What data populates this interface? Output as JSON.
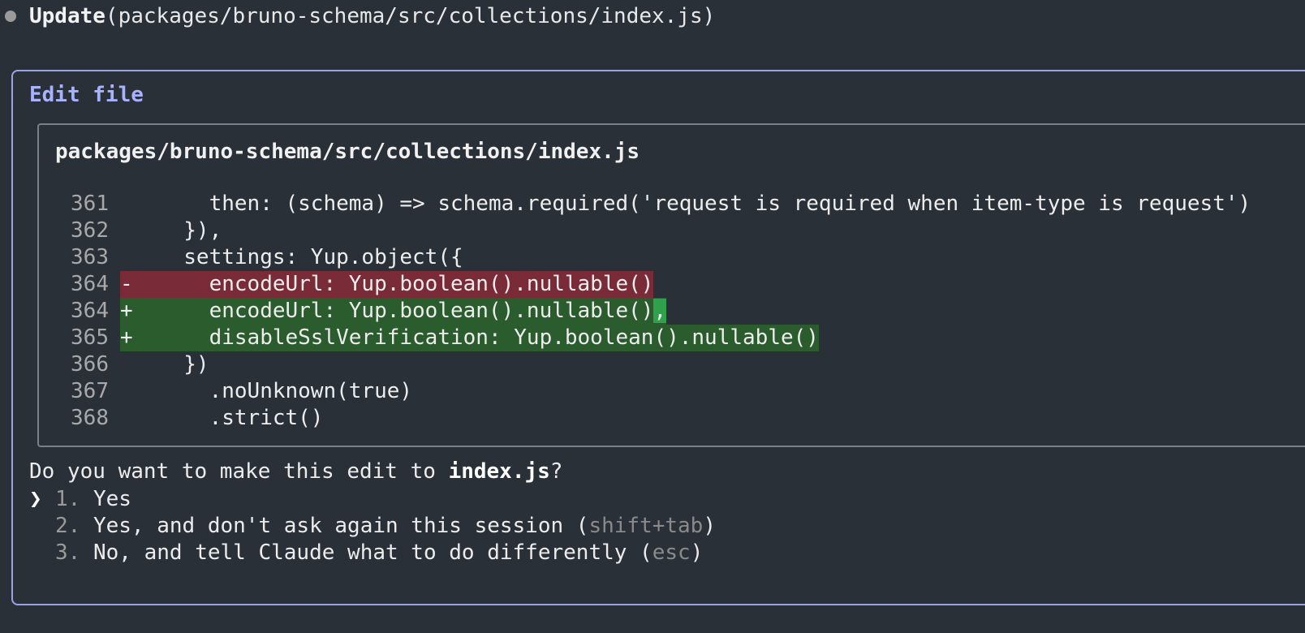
{
  "header": {
    "action": "Update",
    "path_open": "(",
    "path": "packages/bruno-schema/src/collections/index.js",
    "path_close": ")"
  },
  "panel": {
    "title": "Edit file",
    "file_path": "packages/bruno-schema/src/collections/index.js"
  },
  "diff": [
    {
      "ln": "361",
      "marker": " ",
      "type": "context",
      "text": "      then: (schema) => schema.required('request is required when item-type is request')"
    },
    {
      "ln": "362",
      "marker": " ",
      "type": "context",
      "text": "    }),"
    },
    {
      "ln": "363",
      "marker": " ",
      "type": "context",
      "text": "    settings: Yup.object({"
    },
    {
      "ln": "364",
      "marker": "-",
      "type": "removed",
      "text": "      encodeUrl: Yup.boolean().nullable()"
    },
    {
      "ln": "364",
      "marker": "+",
      "type": "added",
      "text": "      encodeUrl: Yup.boolean().nullable()",
      "highlight": ","
    },
    {
      "ln": "365",
      "marker": "+",
      "type": "added",
      "text": "      disableSslVerification: Yup.boolean().nullable()"
    },
    {
      "ln": "366",
      "marker": " ",
      "type": "context",
      "text": "    })"
    },
    {
      "ln": "367",
      "marker": " ",
      "type": "context",
      "text": "      .noUnknown(true)"
    },
    {
      "ln": "368",
      "marker": " ",
      "type": "context",
      "text": "      .strict()"
    }
  ],
  "prompt": {
    "question_prefix": "Do you want to make this edit to ",
    "question_file": "index.js",
    "question_suffix": "?",
    "caret": "❯",
    "options": [
      {
        "num": "1.",
        "label": "Yes",
        "hint": ""
      },
      {
        "num": "2.",
        "label": "Yes, and don't ask again this session (",
        "hint": "shift+tab",
        "close": ")"
      },
      {
        "num": "3.",
        "label": "No, and tell Claude what to do differently (",
        "hint": "esc",
        "close": ")"
      }
    ]
  },
  "colors": {
    "background": "#2a3038",
    "panel_border": "#9aa3e6",
    "removed_bg": "#7a2b38",
    "added_bg": "#2a5c2e",
    "added_highlight": "#2fa14c",
    "title_accent": "#a8b2ff"
  }
}
